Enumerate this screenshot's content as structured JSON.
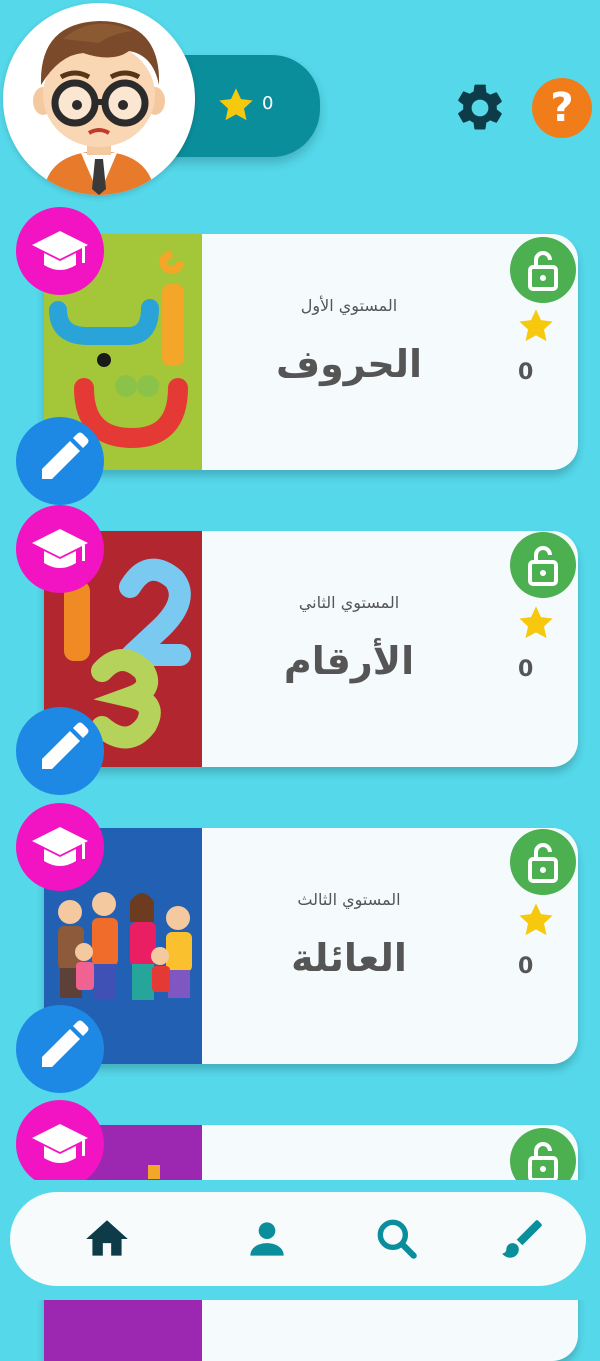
{
  "header": {
    "score": "0",
    "icons": [
      "avatar-teacher",
      "star-icon",
      "gear-icon",
      "help-icon"
    ],
    "help_label": "?"
  },
  "levels": [
    {
      "level_label": "المستوي الأول",
      "title": "الحروف",
      "stars": "0",
      "thumb_color": "#a4c639"
    },
    {
      "level_label": "المستوي الثاني",
      "title": "الأرقام",
      "stars": "0",
      "thumb_color": "#b1262f"
    },
    {
      "level_label": "المستوي الثالث",
      "title": "العائلة",
      "stars": "0",
      "thumb_color": "#2260b4"
    },
    {
      "level_label": "",
      "title": "",
      "stars": "",
      "thumb_color": "#9c27b0"
    }
  ],
  "colors": {
    "background": "#54d8ea",
    "score_pill": "#0b8e9c",
    "lock": "#4caf50",
    "graduation_badge": "#f213c2",
    "edit_badge": "#1e88e5",
    "star": "#f6c90e",
    "help": "#f07d1a",
    "nav_icon": "#0b8e9c"
  },
  "bottom_nav": [
    "home-icon",
    "profile-icon",
    "search-icon",
    "brush-icon"
  ]
}
